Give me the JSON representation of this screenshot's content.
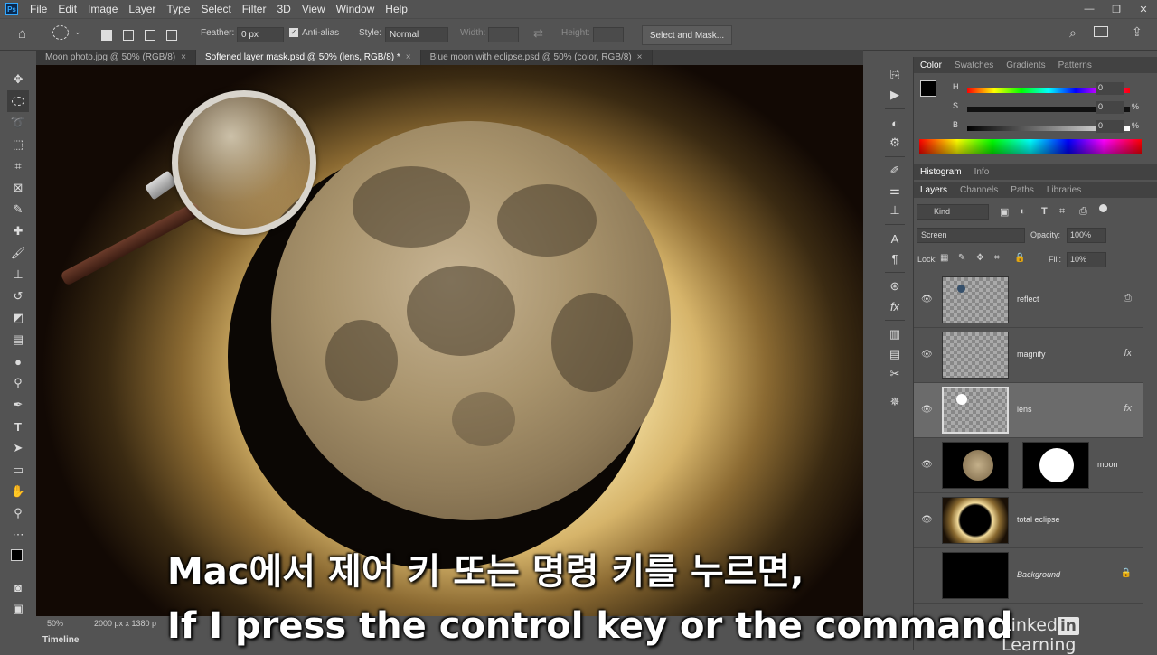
{
  "app": {
    "logo": "Ps",
    "menu": [
      "File",
      "Edit",
      "Image",
      "Layer",
      "Type",
      "Select",
      "Filter",
      "3D",
      "View",
      "Window",
      "Help"
    ],
    "window_controls": [
      "—",
      "❐",
      "✕"
    ]
  },
  "options_bar": {
    "feather_label": "Feather:",
    "feather_value": "0 px",
    "antialias_label": "Anti-alias",
    "style_label": "Style:",
    "style_value": "Normal",
    "width_label": "Width:",
    "height_label": "Height:",
    "select_mask_label": "Select and Mask..."
  },
  "tabs": [
    {
      "label": "Moon photo.jpg @ 50% (RGB/8)",
      "active": false
    },
    {
      "label": "Softened layer mask.psd @ 50% (lens, RGB/8) *",
      "active": true
    },
    {
      "label": "Blue moon with eclipse.psd @ 50% (color, RGB/8)",
      "active": false
    }
  ],
  "status": {
    "zoom": "50%",
    "doc_size": "2000 px x 1380 p",
    "timeline_label": "Timeline"
  },
  "color_panel": {
    "tabs": [
      "Color",
      "Swatches",
      "Gradients",
      "Patterns"
    ],
    "sliders": [
      {
        "label": "H",
        "value": "0",
        "unit": ""
      },
      {
        "label": "S",
        "value": "0",
        "unit": "%"
      },
      {
        "label": "B",
        "value": "0",
        "unit": "%"
      }
    ]
  },
  "histogram_panel": {
    "tabs": [
      "Histogram",
      "Info"
    ]
  },
  "layers_panel": {
    "tabs": [
      "Layers",
      "Channels",
      "Paths",
      "Libraries"
    ],
    "kind_label": "Kind",
    "blend_mode": "Screen",
    "opacity_label": "Opacity:",
    "opacity_value": "100%",
    "lock_label": "Lock:",
    "fill_label": "Fill:",
    "fill_value": "10%",
    "layers": [
      {
        "name": "reflect",
        "fx": false
      },
      {
        "name": "magnify",
        "fx": true
      },
      {
        "name": "lens",
        "fx": true,
        "selected": true
      },
      {
        "name": "moon",
        "fx": false
      },
      {
        "name": "total eclipse",
        "fx": false
      },
      {
        "name": "Background",
        "fx": false,
        "locked": true
      }
    ]
  },
  "subtitles": {
    "korean": "Mac에서 제어 키 또는 명령 키를 누르면,",
    "english": "If I press the control key or the command"
  },
  "watermark": {
    "linked": "Linked",
    "in": "in",
    "learning": " Learning"
  }
}
